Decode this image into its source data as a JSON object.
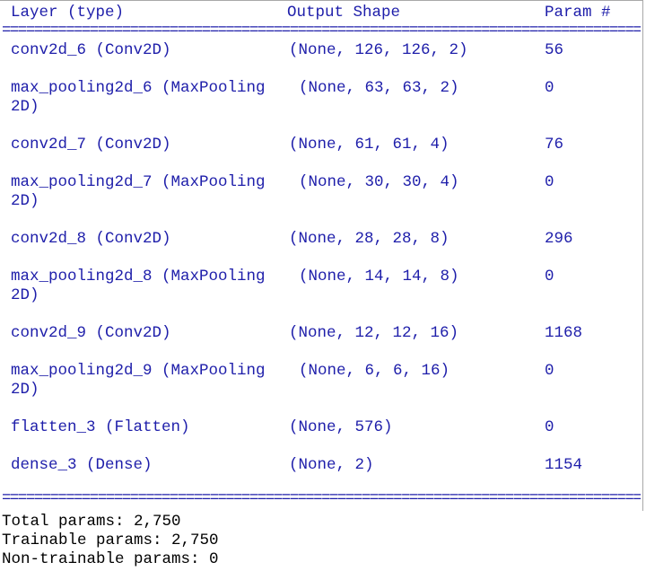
{
  "header": {
    "layer": "Layer (type)",
    "output_shape": "Output Shape",
    "param": "Param #"
  },
  "rule_text": "==================================================================================================================",
  "rows": [
    {
      "layer": "conv2d_6 (Conv2D)",
      "shape": "(None, 126, 126, 2)",
      "param": "56"
    },
    {
      "layer": "max_pooling2d_6 (MaxPooling\n2D)",
      "shape": "(None, 63, 63, 2)",
      "param": "0"
    },
    {
      "layer": "conv2d_7 (Conv2D)",
      "shape": "(None, 61, 61, 4)",
      "param": "76"
    },
    {
      "layer": "max_pooling2d_7 (MaxPooling\n2D)",
      "shape": "(None, 30, 30, 4)",
      "param": "0"
    },
    {
      "layer": "conv2d_8 (Conv2D)",
      "shape": "(None, 28, 28, 8)",
      "param": "296"
    },
    {
      "layer": "max_pooling2d_8 (MaxPooling\n2D)",
      "shape": "(None, 14, 14, 8)",
      "param": "0"
    },
    {
      "layer": "conv2d_9 (Conv2D)",
      "shape": "(None, 12, 12, 16)",
      "param": "1168"
    },
    {
      "layer": "max_pooling2d_9 (MaxPooling\n2D)",
      "shape": "(None, 6, 6, 16)",
      "param": "0"
    },
    {
      "layer": "flatten_3 (Flatten)",
      "shape": "(None, 576)",
      "param": "0"
    },
    {
      "layer": "dense_3 (Dense)",
      "shape": "(None, 2)",
      "param": "1154"
    }
  ],
  "summary": {
    "total": "Total params: 2,750",
    "trainable": "Trainable params: 2,750",
    "non_trainable": "Non-trainable params: 0"
  },
  "colors": {
    "table_text": "#1e1eaa",
    "summary_text": "#000000",
    "border": "#a8a8a8"
  }
}
